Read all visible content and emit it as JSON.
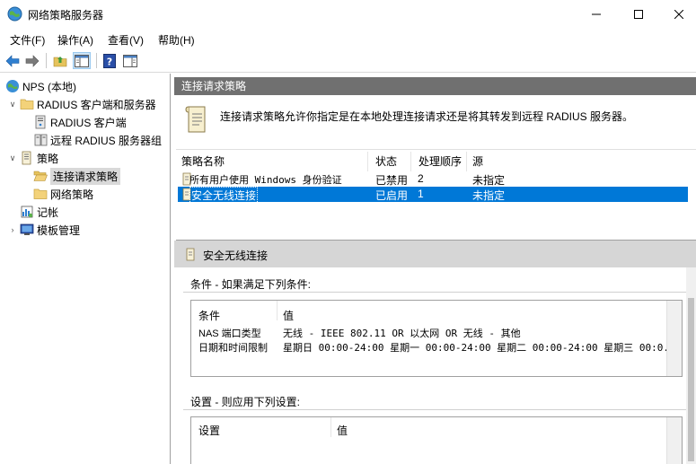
{
  "window": {
    "title": "网络策略服务器",
    "minimize_glyph": "—",
    "maximize_glyph": "☐",
    "close_glyph": "✕"
  },
  "menu": {
    "file": "文件(F)",
    "action": "操作(A)",
    "view": "查看(V)",
    "help": "帮助(H)"
  },
  "toolbar": {
    "icons": [
      "back-arrow-icon",
      "forward-arrow-icon",
      "up-folder-icon",
      "show-hide-tree-icon",
      "help-icon",
      "properties-pane-icon"
    ]
  },
  "tree": {
    "root": "NPS (本地)",
    "radius_clients_servers": "RADIUS 客户端和服务器",
    "radius_clients": "RADIUS 客户端",
    "remote_radius_groups": "远程 RADIUS 服务器组",
    "policies": "策略",
    "connection_request_policies": "连接请求策略",
    "network_policies": "网络策略",
    "accounting": "记帐",
    "templates_management": "模板管理"
  },
  "main": {
    "header": "连接请求策略",
    "description": "连接请求策略允许你指定是在本地处理连接请求还是将其转发到远程 RADIUS 服务器。",
    "columns": {
      "name": "策略名称",
      "status": "状态",
      "order": "处理顺序",
      "source": "源"
    },
    "rows": [
      {
        "name": "所有用户使用 Windows 身份验证",
        "status": "已禁用",
        "order": "2",
        "source": "未指定",
        "selected": false
      },
      {
        "name": "安全无线连接",
        "status": "已启用",
        "order": "1",
        "source": "未指定",
        "selected": true
      }
    ]
  },
  "detail": {
    "title": "安全无线连接",
    "conditions_label": "条件 - 如果满足下列条件:",
    "conditions_headers": {
      "condition": "条件",
      "value": "值"
    },
    "conditions": [
      {
        "condition": "NAS 端口类型",
        "value": "无线 - IEEE 802.11 OR 以太网 OR 无线 - 其他"
      },
      {
        "condition": "日期和时间限制",
        "value": "星期日 00:00-24:00 星期一 00:00-24:00 星期二 00:00-24:00 星期三 00:0..."
      }
    ],
    "settings_label": "设置 - 则应用下列设置:",
    "settings_headers": {
      "setting": "设置",
      "value": "值"
    }
  },
  "colors": {
    "selection": "#0078d7",
    "pane_header": "#707070",
    "detail_header": "#d6d6d6"
  }
}
